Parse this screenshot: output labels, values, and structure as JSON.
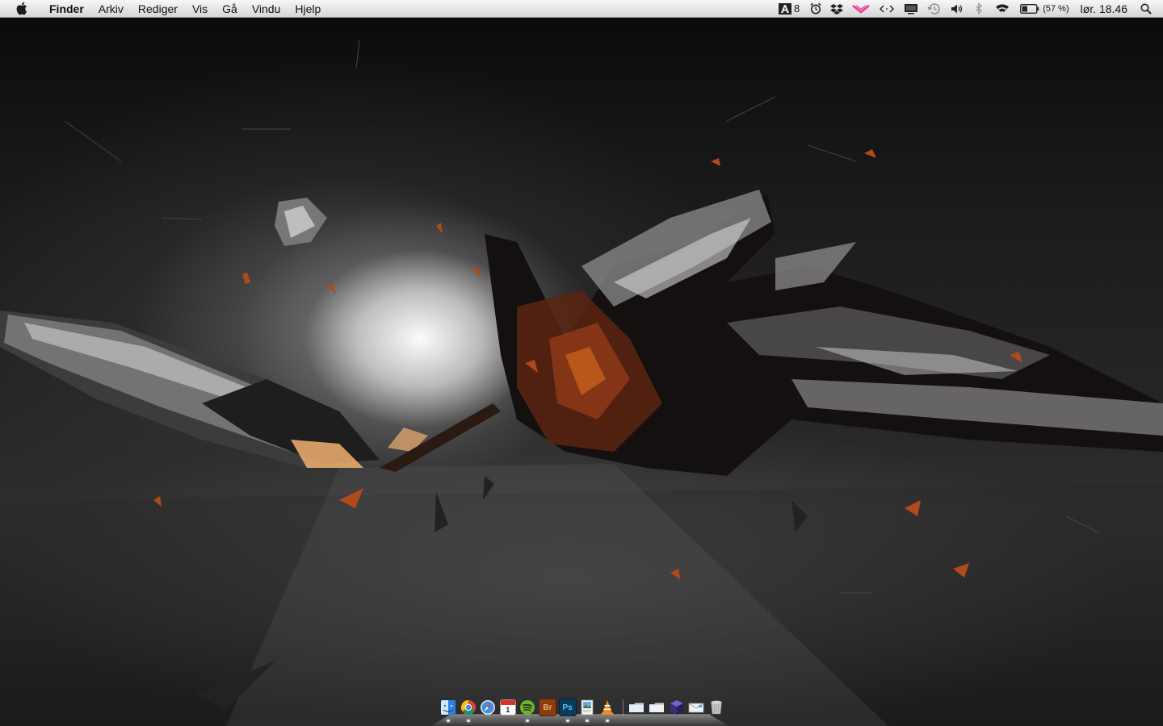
{
  "menubar": {
    "apple_icon": "apple-icon",
    "app_name": "Finder",
    "menus": [
      "Arkiv",
      "Rediger",
      "Vis",
      "Gå",
      "Vindu",
      "Hjelp"
    ],
    "status_items": {
      "adobe_badge": "8",
      "battery_percent": "(57 %)",
      "clock": "lør. 18.46"
    }
  },
  "dock": {
    "items": [
      {
        "name": "finder",
        "icon": "finder-icon",
        "running": true
      },
      {
        "name": "chrome",
        "icon": "chrome-icon",
        "running": true
      },
      {
        "name": "safari",
        "icon": "safari-icon",
        "running": false
      },
      {
        "name": "calendar",
        "icon": "calendar-icon",
        "label": "1",
        "running": false
      },
      {
        "name": "spotify",
        "icon": "spotify-icon",
        "running": true
      },
      {
        "name": "bridge",
        "icon": "bridge-icon",
        "label": "Br",
        "running": false
      },
      {
        "name": "photoshop",
        "icon": "photoshop-icon",
        "label": "Ps",
        "running": true
      },
      {
        "name": "preview",
        "icon": "preview-icon",
        "running": true
      },
      {
        "name": "vlc",
        "icon": "vlc-icon",
        "running": true
      },
      {
        "name": "folder-applications",
        "icon": "folder-icon",
        "running": false
      },
      {
        "name": "folder-documents",
        "icon": "folder-icon",
        "running": false
      },
      {
        "name": "box",
        "icon": "box-icon",
        "running": false
      },
      {
        "name": "mail-app",
        "icon": "envelope-icon",
        "running": false
      },
      {
        "name": "trash",
        "icon": "trash-icon",
        "running": false
      }
    ]
  },
  "colors": {
    "accent_orange": "#c85a1e",
    "menubar_top": "#f7f7f7",
    "menubar_bottom": "#d5d5d5"
  }
}
